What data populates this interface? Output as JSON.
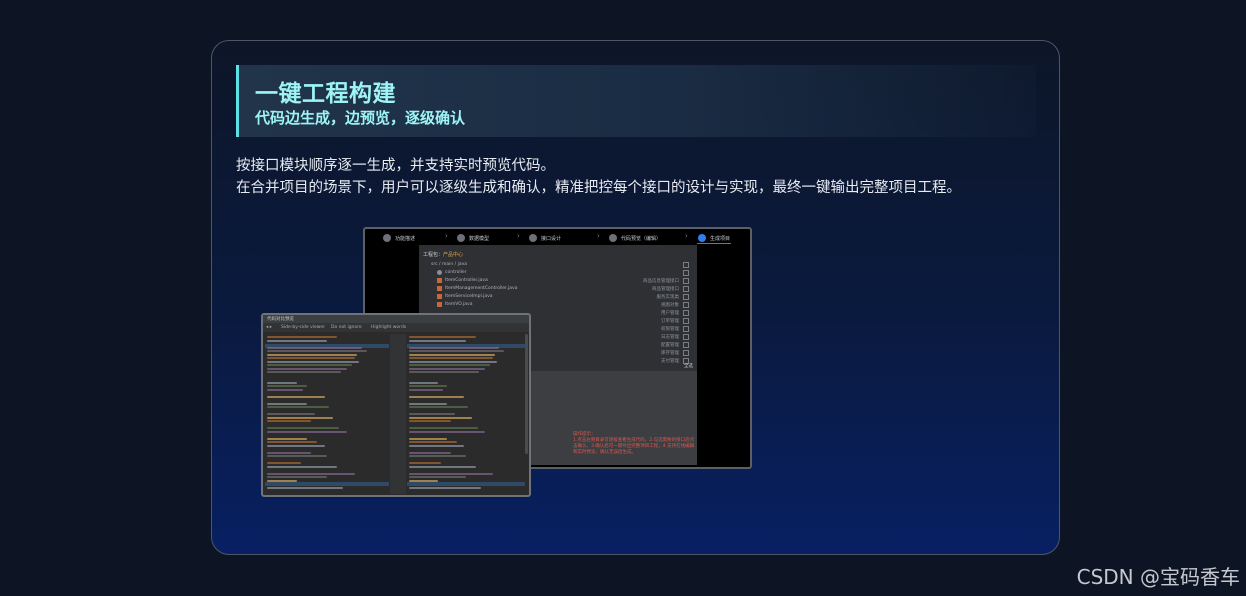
{
  "banner": {
    "title": "一键工程构建",
    "subtitle": "代码边生成，边预览，逐级确认"
  },
  "description": {
    "line1": "按接口模块顺序逐一生成，并支持实时预览代码。",
    "line2": "在合并项目的场景下，用户可以逐级生成和确认，精准把控每个接口的设计与实现，最终一键输出完整项目工程。"
  },
  "wizard": {
    "steps": [
      {
        "label": "功能描述",
        "active": false
      },
      {
        "label": "数据模型",
        "active": false
      },
      {
        "label": "接口设计",
        "active": false
      },
      {
        "label": "代码预览（编辑）",
        "active": false
      },
      {
        "label": "生成项目",
        "active": true
      }
    ],
    "panel_header_prefix": "工程包：",
    "panel_header_name": "产品中心",
    "tree_root": "src / main / java",
    "tree_items": [
      {
        "name": "controller",
        "desc": ""
      },
      {
        "name": "ItemController.java",
        "desc": "商品信息管理接口"
      },
      {
        "name": "ItemManagementController.java",
        "desc": "商品管理接口"
      },
      {
        "name": "ItemServiceImpl.java",
        "desc": "服务实现类"
      },
      {
        "name": "ItemVO.java",
        "desc": "视图对象"
      }
    ],
    "extra_descs": [
      "用户管理",
      "订单管理",
      "权限管理",
      "日志管理",
      "配置管理",
      "库存管理",
      "支付管理",
      "消息通知"
    ],
    "footer_label": "全选",
    "note_title": "操作提示：",
    "note_text": "1.点击左侧目录可逐级查看生成代码，2.勾选需要的接口后点击确认，3.确认后可一键导出完整项目工程，4.支持在线编辑和实时预览，确认无误后生成。"
  },
  "diff_window": {
    "title": "代码对比预览",
    "toolbar": [
      "◂ ▸",
      "Side-by-side viewer",
      "Do not ignore",
      "Highlight words"
    ]
  },
  "colors": {
    "accent_cyan": "#9ef4f4",
    "step_active": "#2f7df0",
    "note_red": "#e0564d"
  },
  "watermark": "CSDN @宝码香车"
}
